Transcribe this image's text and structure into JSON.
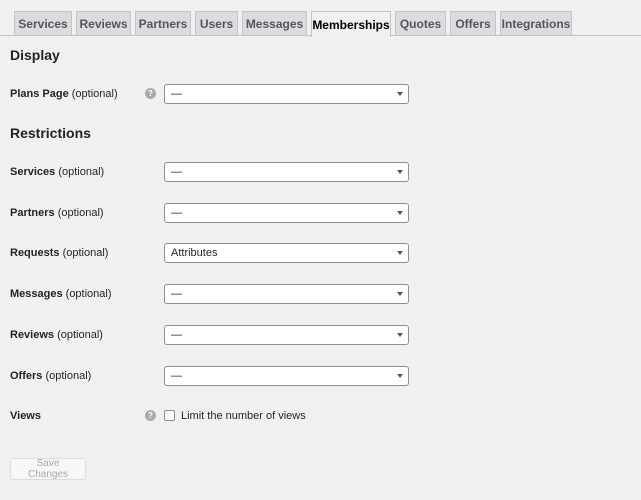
{
  "tabs": [
    {
      "label": "Services"
    },
    {
      "label": "Reviews"
    },
    {
      "label": "Partners"
    },
    {
      "label": "Users"
    },
    {
      "label": "Messages"
    },
    {
      "label": "Memberships",
      "active": true
    },
    {
      "label": "Quotes"
    },
    {
      "label": "Offers"
    },
    {
      "label": "Integrations"
    }
  ],
  "display": {
    "title": "Display",
    "plans_page": {
      "label": "Plans Page",
      "optional": "(optional)",
      "value": "—",
      "help_icon": "question-icon"
    }
  },
  "restrictions": {
    "title": "Restrictions",
    "services": {
      "label": "Services",
      "optional": "(optional)",
      "value": "—"
    },
    "partners": {
      "label": "Partners",
      "optional": "(optional)",
      "value": "—"
    },
    "requests": {
      "label": "Requests",
      "optional": "(optional)",
      "value": "Attributes"
    },
    "messages": {
      "label": "Messages",
      "optional": "(optional)",
      "value": "—"
    },
    "reviews": {
      "label": "Reviews",
      "optional": "(optional)",
      "value": "—"
    },
    "offers": {
      "label": "Offers",
      "optional": "(optional)",
      "value": "—"
    },
    "views": {
      "label": "Views",
      "checkbox_label": "Limit the number of views",
      "checked": false,
      "help_icon": "question-icon"
    }
  },
  "actions": {
    "save_label": "Save Changes"
  }
}
